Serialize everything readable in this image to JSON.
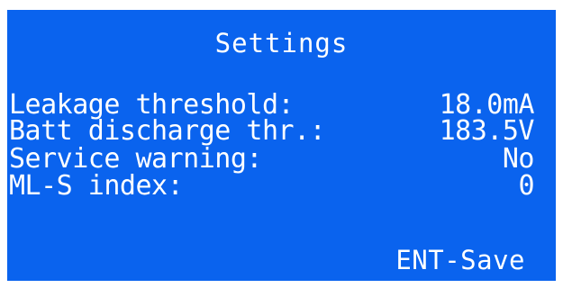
{
  "screen": {
    "background_color": "#0a63ee",
    "text_color": "#ffffff",
    "title": "Settings",
    "rows": [
      {
        "label": "Leakage threshold:",
        "value": "18.0mA"
      },
      {
        "label": "Batt discharge thr.:",
        "value": "183.5V"
      },
      {
        "label": "Service warning:",
        "value": "No"
      },
      {
        "label": "ML-S index:",
        "value": "0"
      }
    ],
    "footer_hint": "ENT-Save"
  }
}
